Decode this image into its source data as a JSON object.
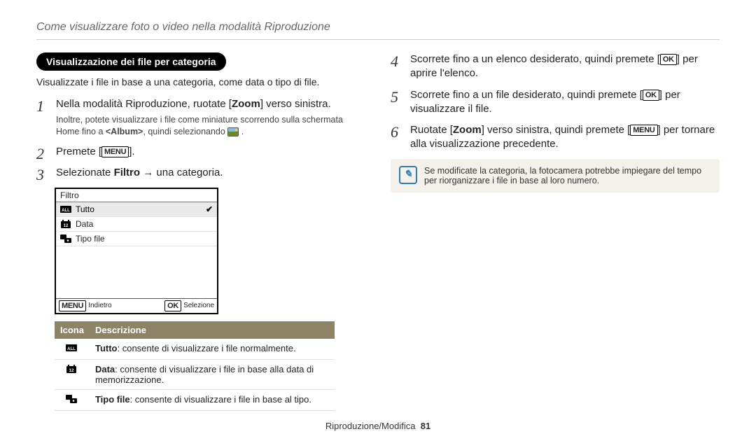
{
  "header": {
    "title": "Come visualizzare foto o video nella modalità Riproduzione"
  },
  "left": {
    "section_title": "Visualizzazione dei file per categoria",
    "section_desc": "Visualizzate i file in base a una categoria, come data o tipo di file.",
    "step1": {
      "pre": "Nella modalità Riproduzione, ruotate [",
      "zoom": "Zoom",
      "post": "] verso sinistra."
    },
    "step1_sub": {
      "a": "Inoltre, potete visualizzare i file come miniature scorrendo sulla schermata Home fino a ",
      "b": "<Album>",
      "c": ", quindi selezionando "
    },
    "step2": {
      "pre": "Premete [",
      "menu": "MENU",
      "post": "]."
    },
    "step3": {
      "a": "Selezionate ",
      "b": "Filtro",
      "arrow": " → ",
      "c": "una categoria."
    },
    "screen": {
      "title": "Filtro",
      "rows": [
        {
          "label": "Tutto",
          "selected": true
        },
        {
          "label": "Data",
          "selected": false
        },
        {
          "label": "Tipo file",
          "selected": false
        }
      ],
      "footer": {
        "back_btn": "MENU",
        "back_label": "Indietro",
        "sel_btn": "OK",
        "sel_label": "Selezione"
      }
    },
    "table": {
      "head_icon": "Icona",
      "head_desc": "Descrizione",
      "rows": [
        {
          "term": "Tutto",
          "desc": ": consente di visualizzare i file normalmente."
        },
        {
          "term": "Data",
          "desc": ": consente di visualizzare i file in base alla data di memorizzazione."
        },
        {
          "term": "Tipo file",
          "desc": ": consente di visualizzare i file in base al tipo."
        }
      ]
    }
  },
  "right": {
    "step4": {
      "a": "Scorrete fino a un elenco desiderato, quindi premete [",
      "ok": "OK",
      "b": "] per aprire l'elenco."
    },
    "step5": {
      "a": "Scorrete fino a un file desiderato, quindi premete [",
      "ok": "OK",
      "b": "] per visualizzare il file."
    },
    "step6": {
      "a": "Ruotate [",
      "zoom": "Zoom",
      "b": "] verso sinistra, quindi premete [",
      "menu": "MENU",
      "c": "] per tornare alla visualizzazione precedente."
    },
    "note": "Se modificate la categoria, la fotocamera potrebbe impiegare del tempo per riorganizzare i file in base al loro numero."
  },
  "footer": {
    "section": "Riproduzione/Modifica",
    "page": "81"
  }
}
